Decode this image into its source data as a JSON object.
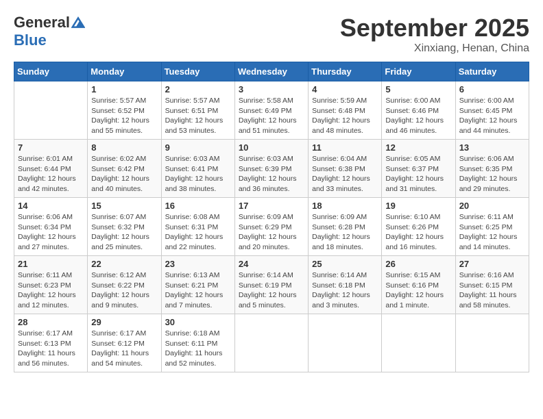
{
  "header": {
    "logo": {
      "general": "General",
      "blue": "Blue",
      "tagline": ""
    },
    "title": "September 2025",
    "location": "Xinxiang, Henan, China"
  },
  "days_of_week": [
    "Sunday",
    "Monday",
    "Tuesday",
    "Wednesday",
    "Thursday",
    "Friday",
    "Saturday"
  ],
  "weeks": [
    [
      {
        "day": "",
        "info": ""
      },
      {
        "day": "1",
        "info": "Sunrise: 5:57 AM\nSunset: 6:52 PM\nDaylight: 12 hours\nand 55 minutes."
      },
      {
        "day": "2",
        "info": "Sunrise: 5:57 AM\nSunset: 6:51 PM\nDaylight: 12 hours\nand 53 minutes."
      },
      {
        "day": "3",
        "info": "Sunrise: 5:58 AM\nSunset: 6:49 PM\nDaylight: 12 hours\nand 51 minutes."
      },
      {
        "day": "4",
        "info": "Sunrise: 5:59 AM\nSunset: 6:48 PM\nDaylight: 12 hours\nand 48 minutes."
      },
      {
        "day": "5",
        "info": "Sunrise: 6:00 AM\nSunset: 6:46 PM\nDaylight: 12 hours\nand 46 minutes."
      },
      {
        "day": "6",
        "info": "Sunrise: 6:00 AM\nSunset: 6:45 PM\nDaylight: 12 hours\nand 44 minutes."
      }
    ],
    [
      {
        "day": "7",
        "info": "Sunrise: 6:01 AM\nSunset: 6:44 PM\nDaylight: 12 hours\nand 42 minutes."
      },
      {
        "day": "8",
        "info": "Sunrise: 6:02 AM\nSunset: 6:42 PM\nDaylight: 12 hours\nand 40 minutes."
      },
      {
        "day": "9",
        "info": "Sunrise: 6:03 AM\nSunset: 6:41 PM\nDaylight: 12 hours\nand 38 minutes."
      },
      {
        "day": "10",
        "info": "Sunrise: 6:03 AM\nSunset: 6:39 PM\nDaylight: 12 hours\nand 36 minutes."
      },
      {
        "day": "11",
        "info": "Sunrise: 6:04 AM\nSunset: 6:38 PM\nDaylight: 12 hours\nand 33 minutes."
      },
      {
        "day": "12",
        "info": "Sunrise: 6:05 AM\nSunset: 6:37 PM\nDaylight: 12 hours\nand 31 minutes."
      },
      {
        "day": "13",
        "info": "Sunrise: 6:06 AM\nSunset: 6:35 PM\nDaylight: 12 hours\nand 29 minutes."
      }
    ],
    [
      {
        "day": "14",
        "info": "Sunrise: 6:06 AM\nSunset: 6:34 PM\nDaylight: 12 hours\nand 27 minutes."
      },
      {
        "day": "15",
        "info": "Sunrise: 6:07 AM\nSunset: 6:32 PM\nDaylight: 12 hours\nand 25 minutes."
      },
      {
        "day": "16",
        "info": "Sunrise: 6:08 AM\nSunset: 6:31 PM\nDaylight: 12 hours\nand 22 minutes."
      },
      {
        "day": "17",
        "info": "Sunrise: 6:09 AM\nSunset: 6:29 PM\nDaylight: 12 hours\nand 20 minutes."
      },
      {
        "day": "18",
        "info": "Sunrise: 6:09 AM\nSunset: 6:28 PM\nDaylight: 12 hours\nand 18 minutes."
      },
      {
        "day": "19",
        "info": "Sunrise: 6:10 AM\nSunset: 6:26 PM\nDaylight: 12 hours\nand 16 minutes."
      },
      {
        "day": "20",
        "info": "Sunrise: 6:11 AM\nSunset: 6:25 PM\nDaylight: 12 hours\nand 14 minutes."
      }
    ],
    [
      {
        "day": "21",
        "info": "Sunrise: 6:11 AM\nSunset: 6:23 PM\nDaylight: 12 hours\nand 12 minutes."
      },
      {
        "day": "22",
        "info": "Sunrise: 6:12 AM\nSunset: 6:22 PM\nDaylight: 12 hours\nand 9 minutes."
      },
      {
        "day": "23",
        "info": "Sunrise: 6:13 AM\nSunset: 6:21 PM\nDaylight: 12 hours\nand 7 minutes."
      },
      {
        "day": "24",
        "info": "Sunrise: 6:14 AM\nSunset: 6:19 PM\nDaylight: 12 hours\nand 5 minutes."
      },
      {
        "day": "25",
        "info": "Sunrise: 6:14 AM\nSunset: 6:18 PM\nDaylight: 12 hours\nand 3 minutes."
      },
      {
        "day": "26",
        "info": "Sunrise: 6:15 AM\nSunset: 6:16 PM\nDaylight: 12 hours\nand 1 minute."
      },
      {
        "day": "27",
        "info": "Sunrise: 6:16 AM\nSunset: 6:15 PM\nDaylight: 11 hours\nand 58 minutes."
      }
    ],
    [
      {
        "day": "28",
        "info": "Sunrise: 6:17 AM\nSunset: 6:13 PM\nDaylight: 11 hours\nand 56 minutes."
      },
      {
        "day": "29",
        "info": "Sunrise: 6:17 AM\nSunset: 6:12 PM\nDaylight: 11 hours\nand 54 minutes."
      },
      {
        "day": "30",
        "info": "Sunrise: 6:18 AM\nSunset: 6:11 PM\nDaylight: 11 hours\nand 52 minutes."
      },
      {
        "day": "",
        "info": ""
      },
      {
        "day": "",
        "info": ""
      },
      {
        "day": "",
        "info": ""
      },
      {
        "day": "",
        "info": ""
      }
    ]
  ]
}
